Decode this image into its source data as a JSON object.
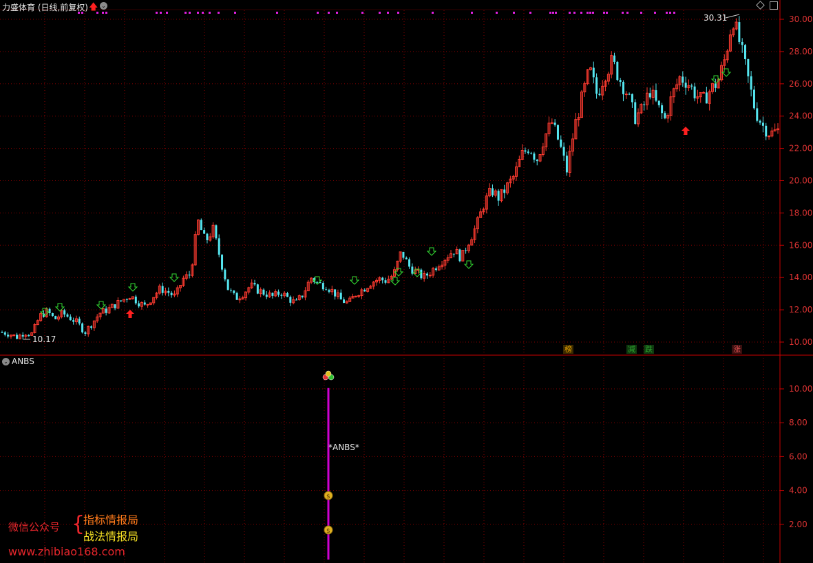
{
  "main_panel": {
    "title": "力盛体育 (日线,前复权)",
    "high_label": "30.31",
    "low_label": "10.17",
    "price_ticks": [
      "30.00",
      "28.00",
      "26.00",
      "24.00",
      "22.00",
      "20.00",
      "18.00",
      "16.00",
      "14.00",
      "12.00",
      "10.00"
    ],
    "event_tags": [
      {
        "text": "榜",
        "color": "#e0a000"
      },
      {
        "text": "减",
        "color": "#2ea02e"
      },
      {
        "text": "跌",
        "color": "#2ea02e"
      },
      {
        "text": "涨",
        "color": "#c0392b"
      }
    ],
    "up_color": "#ff3b30",
    "down_color": "#55e6f0",
    "grid_color": "#8b0000"
  },
  "sub_panel": {
    "title": "ANBS",
    "signal_label": "*ANBS*",
    "value_ticks": [
      "10.00",
      "8.00",
      "6.00",
      "4.00",
      "2.00"
    ],
    "signal_bar_color": "#d000d0"
  },
  "watermark": {
    "wechat_label": "微信公众号",
    "account_1": "指标情报局",
    "account_2": "战法情报局",
    "website": "www.zhibiao168.com"
  },
  "chart_data": {
    "type": "candlestick",
    "y_range": [
      9.3,
      30.5
    ],
    "up_color": "#ff3b30",
    "down_color": "#55e6f0",
    "path": [
      10.6,
      10.5,
      10.3,
      10.6,
      10.5,
      11.6,
      11.9,
      11.4,
      11.8,
      11.5,
      11.2,
      10.6,
      11.2,
      11.8,
      12.0,
      12.3,
      12.6,
      12.9,
      12.5,
      12.2,
      12.8,
      13.3,
      13.1,
      12.8,
      13.9,
      14.2,
      17.5,
      16.2,
      17.0,
      15.1,
      13.3,
      12.7,
      13.0,
      13.5,
      13.2,
      13.0,
      12.8,
      13.1,
      12.7,
      12.4,
      13.0,
      14.0,
      13.6,
      13.5,
      13.1,
      12.6,
      12.4,
      13.0,
      13.3,
      13.7,
      13.9,
      13.8,
      14.2,
      15.6,
      14.7,
      14.3,
      14.0,
      14.4,
      14.9,
      15.3,
      15.7,
      15.2,
      16.3,
      17.2,
      18.6,
      19.4,
      18.9,
      19.6,
      20.3,
      21.6,
      22.1,
      21.3,
      22.7,
      23.6,
      22.3,
      20.6,
      23.3,
      25.1,
      26.9,
      25.3,
      26.6,
      27.4,
      26.3,
      25.4,
      23.9,
      24.4,
      25.6,
      24.6,
      23.8,
      25.3,
      26.4,
      26.1,
      25.4,
      24.9,
      25.6,
      26.1,
      27.6,
      30.1,
      28.4,
      26.4,
      24.3,
      23.4,
      22.9,
      23.1
    ]
  }
}
